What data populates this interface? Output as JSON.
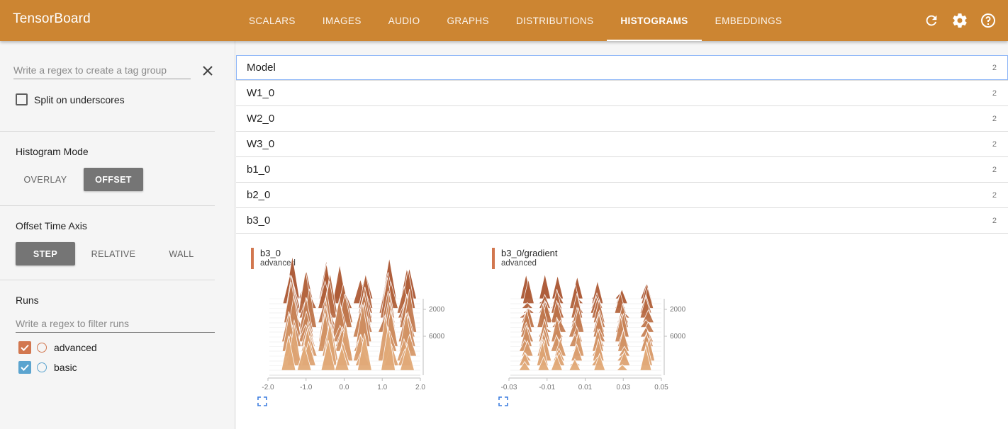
{
  "app": {
    "title": "TensorBoard"
  },
  "nav": {
    "tabs": [
      {
        "label": "SCALARS"
      },
      {
        "label": "IMAGES"
      },
      {
        "label": "AUDIO"
      },
      {
        "label": "GRAPHS"
      },
      {
        "label": "DISTRIBUTIONS"
      },
      {
        "label": "HISTOGRAMS"
      },
      {
        "label": "EMBEDDINGS"
      }
    ],
    "active_tab": "HISTOGRAMS"
  },
  "toolbar": {
    "icons": [
      "refresh-icon",
      "settings-icon",
      "help-icon"
    ]
  },
  "sidebar": {
    "tag_group_placeholder": "Write a regex to create a tag group",
    "tag_group_value": "",
    "split_label": "Split on underscores",
    "split_checked": false,
    "histogram_mode": {
      "title": "Histogram Mode",
      "options": [
        "OVERLAY",
        "OFFSET"
      ],
      "selected": "OFFSET"
    },
    "offset_axis": {
      "title": "Offset Time Axis",
      "options": [
        "STEP",
        "RELATIVE",
        "WALL"
      ],
      "selected": "STEP"
    },
    "runs": {
      "title": "Runs",
      "filter_placeholder": "Write a regex to filter runs",
      "items": [
        {
          "name": "advanced",
          "checked": true,
          "color": "#d2774f"
        },
        {
          "name": "basic",
          "checked": true,
          "color": "#5ba4cf"
        }
      ]
    }
  },
  "main": {
    "tags": [
      {
        "name": "Model",
        "count": "2"
      },
      {
        "name": "W1_0",
        "count": "2"
      },
      {
        "name": "W2_0",
        "count": "2"
      },
      {
        "name": "W3_0",
        "count": "2"
      },
      {
        "name": "b1_0",
        "count": "2"
      },
      {
        "name": "b2_0",
        "count": "2"
      },
      {
        "name": "b3_0",
        "count": "2"
      }
    ],
    "cards": [
      {
        "title": "b3_0",
        "run": "advanced",
        "x_ticks": [
          "-2.0",
          "-1.0",
          "0.0",
          "1.0",
          "2.0"
        ],
        "y_ticks": [
          "2000",
          "6000"
        ]
      },
      {
        "title": "b3_0/gradient",
        "run": "advanced",
        "x_ticks": [
          "-0.03",
          "-0.01",
          "0.01",
          "0.03",
          "0.05"
        ],
        "y_ticks": [
          "2000",
          "6000"
        ]
      }
    ]
  },
  "colors": {
    "header": "#cc8532",
    "run_advanced": "#d2774f",
    "run_basic": "#5ba4cf",
    "button_active": "#757575"
  }
}
